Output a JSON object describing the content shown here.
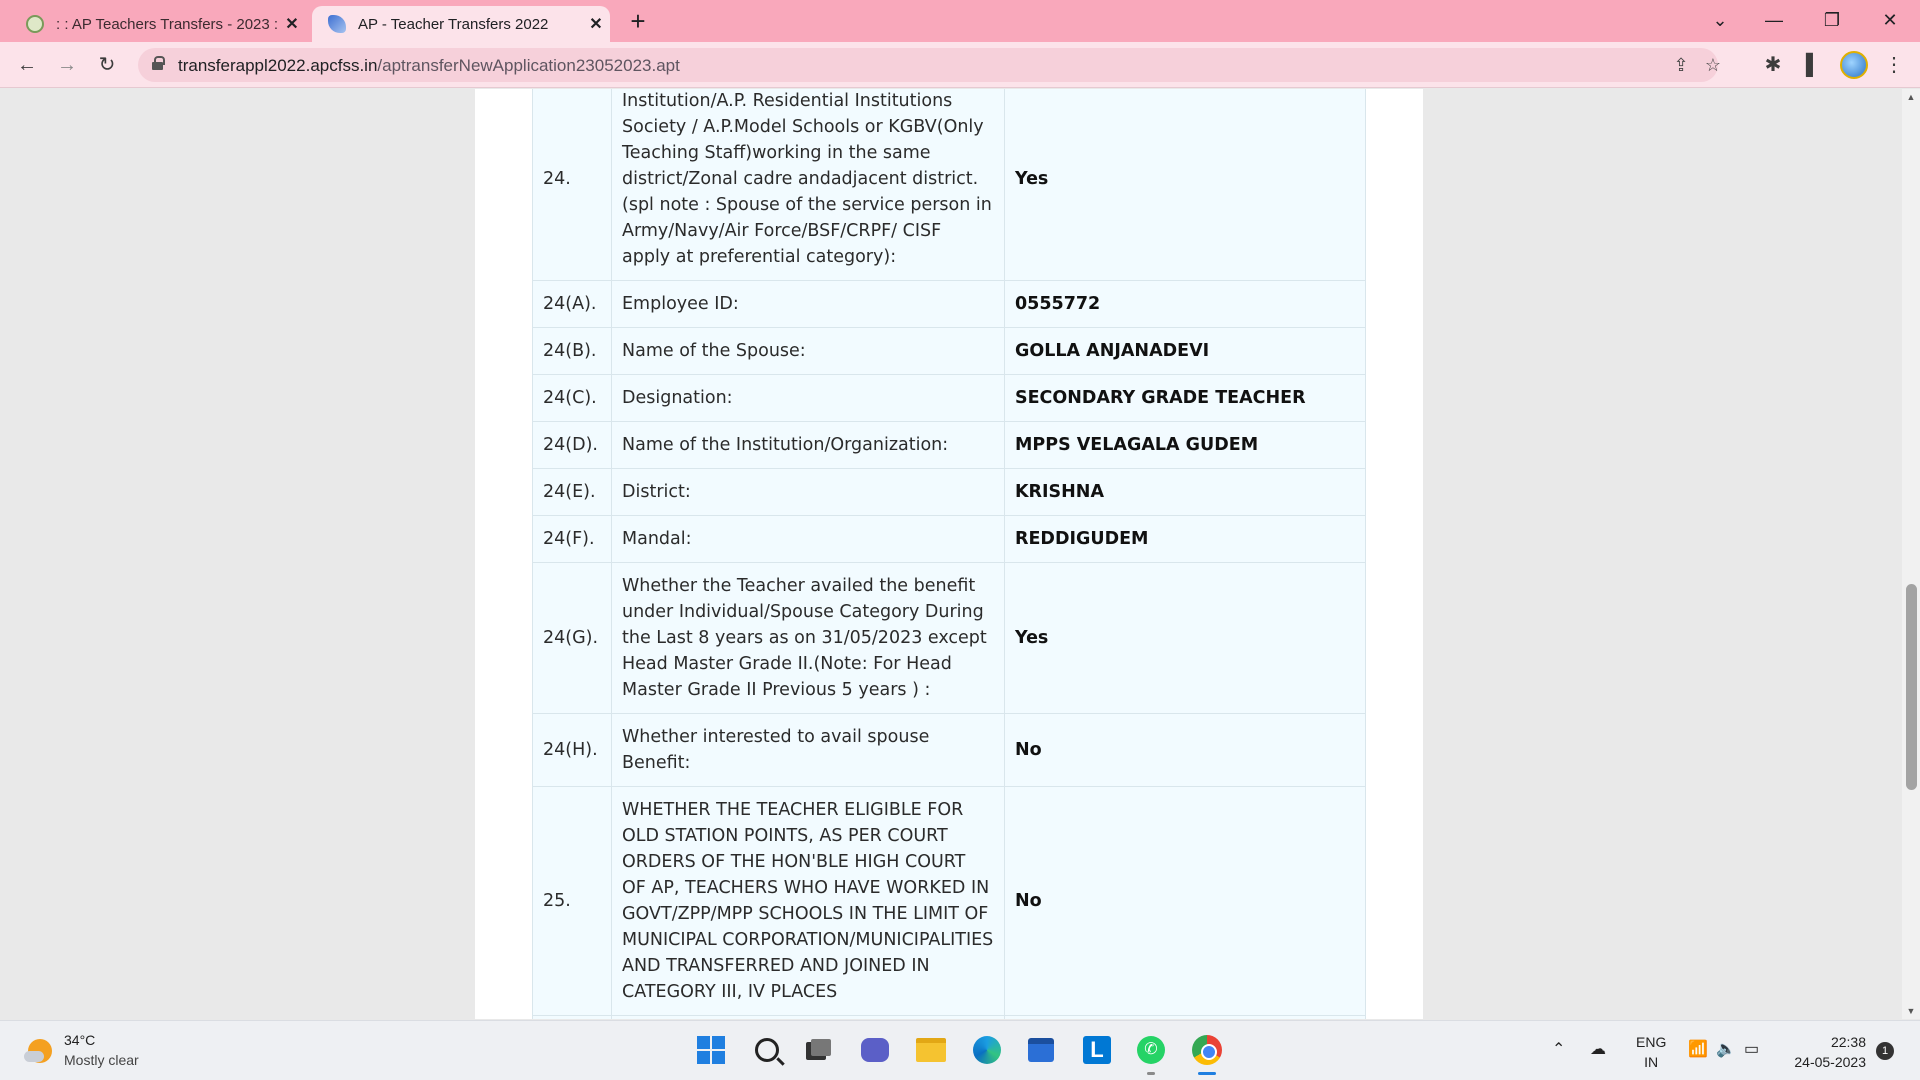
{
  "browser": {
    "tabs": [
      {
        "title": ": : AP Teachers Transfers - 2023 : :",
        "active": false
      },
      {
        "title": "AP - Teacher Transfers 2022",
        "active": true
      }
    ],
    "url_host": "transferappl2022.apcfss.in",
    "url_path": "/aptransferNewApplication23052023.apt"
  },
  "form": {
    "rows": [
      {
        "num": "24.",
        "label": "Institution/A.P. Residential Institutions Society / A.P.Model Schools or KGBV(Only Teaching Staff)working in the same district/Zonal cadre andadjacent district. (spl note : Spouse of the service person in Army/Navy/Air Force/BSF/CRPF/ CISF apply at preferential category):",
        "value": "Yes"
      },
      {
        "num": "24(A).",
        "label": "Employee ID:",
        "value": "0555772"
      },
      {
        "num": "24(B).",
        "label": "Name of the Spouse:",
        "value": "GOLLA ANJANADEVI"
      },
      {
        "num": "24(C).",
        "label": "Designation:",
        "value": "SECONDARY GRADE TEACHER"
      },
      {
        "num": "24(D).",
        "label": "Name of the Institution/Organization:",
        "value": "MPPS VELAGALA GUDEM"
      },
      {
        "num": "24(E).",
        "label": "District:",
        "value": "KRISHNA"
      },
      {
        "num": "24(F).",
        "label": "Mandal:",
        "value": "REDDIGUDEM"
      },
      {
        "num": "24(G).",
        "label": "Whether the Teacher availed the benefit under Individual/Spouse Category During the Last 8 years as on 31/05/2023 except Head Master Grade II.(Note: For Head Master Grade II Previous 5 years ) :",
        "value": "Yes"
      },
      {
        "num": "24(H).",
        "label": "Whether interested to avail spouse Benefit:",
        "value": "No"
      },
      {
        "num": "25.",
        "label": "WHETHER THE TEACHER ELIGIBLE FOR OLD STATION POINTS, AS PER COURT ORDERS OF THE HON'BLE HIGH COURT OF AP, TEACHERS WHO HAVE WORKED IN GOVT/ZPP/MPP SCHOOLS IN THE LIMIT OF MUNICIPAL CORPORATION/MUNICIPALITIES AND TRANSFERRED AND JOINED IN CATEGORY III, IV PLACES",
        "value": "No"
      }
    ]
  },
  "taskbar": {
    "temperature": "34°C",
    "condition": "Mostly clear",
    "lang_line1": "ENG",
    "lang_line2": "IN",
    "time": "22:38",
    "date": "24-05-2023",
    "notifications": "1"
  },
  "icons": {
    "tab_close": "close-icon",
    "new_tab": "plus-icon",
    "back": "arrow-left-icon",
    "forward": "arrow-right-icon",
    "reload": "reload-icon",
    "share": "share-icon",
    "bookmark": "star-icon",
    "extensions": "puzzle-icon",
    "sidepanel": "side-panel-icon",
    "menu": "kebab-menu-icon"
  }
}
